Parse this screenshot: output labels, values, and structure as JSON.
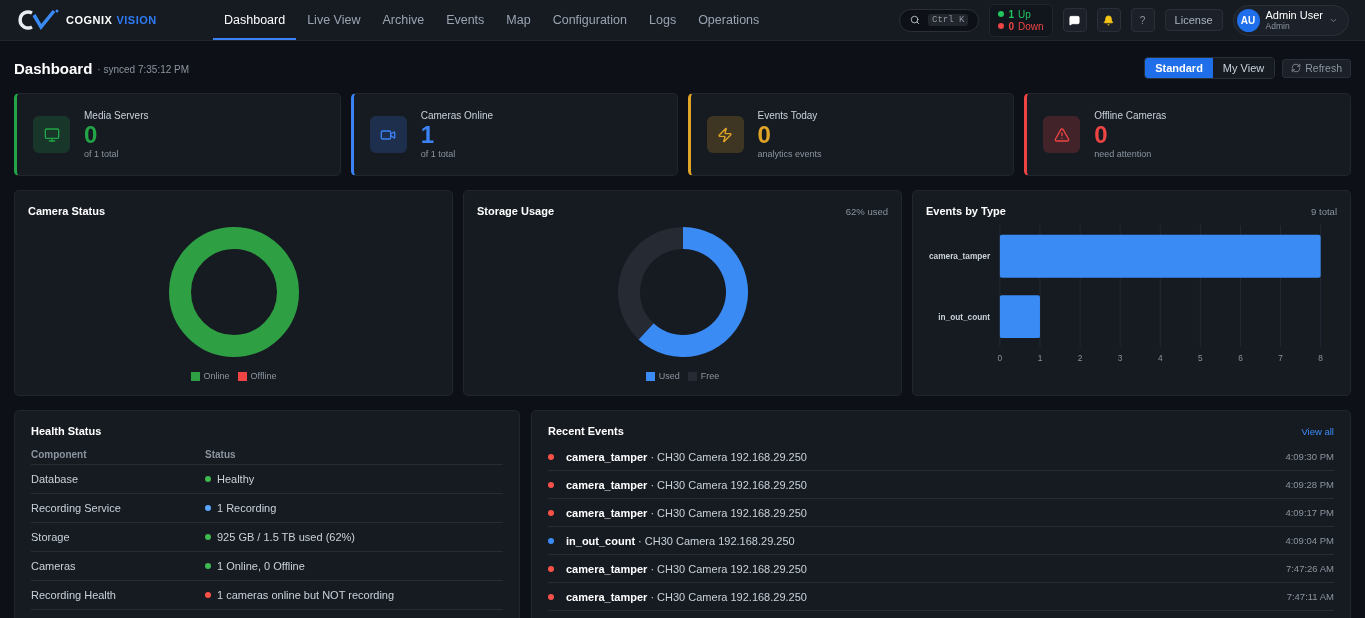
{
  "brand": {
    "first": "COGNIX",
    "second": "VISION"
  },
  "nav": [
    {
      "label": "Dashboard",
      "selected": true
    },
    {
      "label": "Live View",
      "selected": false
    },
    {
      "label": "Archive",
      "selected": false
    },
    {
      "label": "Events",
      "selected": false
    },
    {
      "label": "Map",
      "selected": false
    },
    {
      "label": "Configuration",
      "selected": false
    },
    {
      "label": "Logs",
      "selected": false
    },
    {
      "label": "Operations",
      "selected": false
    }
  ],
  "search": {
    "shortcut": "Ctrl K"
  },
  "server_status": [
    {
      "count": "1",
      "label": "Up",
      "color": "#22c55e"
    },
    {
      "count": "0",
      "label": "Down",
      "color": "#ef4444"
    }
  ],
  "help_label": "?",
  "license_button": "License",
  "user": {
    "initials": "AU",
    "name": "Admin User",
    "role": "Admin"
  },
  "page": {
    "title": "Dashboard",
    "synced": "· synced 7:35:12 PM"
  },
  "views": [
    {
      "label": "Standard",
      "selected": true
    },
    {
      "label": "My View",
      "selected": false
    }
  ],
  "refresh_button": "Refresh",
  "stats": [
    {
      "kind": "monitor",
      "label": "Media Servers",
      "value": "0",
      "sub": "of 1 total",
      "color": "#22a447"
    },
    {
      "kind": "video",
      "label": "Cameras Online",
      "value": "1",
      "sub": "of 1 total",
      "color": "#3b82f6"
    },
    {
      "kind": "zap",
      "label": "Events Today",
      "value": "0",
      "sub": "analytics events",
      "color": "#e0a526"
    },
    {
      "kind": "alert",
      "label": "Offline Cameras",
      "value": "0",
      "sub": "need attention",
      "color": "#ef4444"
    }
  ],
  "camera_status": {
    "title": "Camera Status",
    "legend": [
      {
        "label": "Online",
        "color": "#2ea043"
      },
      {
        "label": "Offline",
        "color": "#ef4444"
      }
    ]
  },
  "storage_usage": {
    "title": "Storage Usage",
    "note": "62% used",
    "chart_data": {
      "type": "donut",
      "categories": [
        "Used",
        "Free"
      ],
      "values": [
        62,
        38
      ],
      "colors": [
        "#3b8bf5",
        "#252a33"
      ]
    }
  },
  "events_by_type": {
    "title": "Events by Type",
    "note": "9 total",
    "chart_data": {
      "type": "bar",
      "orientation": "horizontal",
      "grid": true,
      "categories": [
        "camera_tamper",
        "in_out_count"
      ],
      "values": [
        8,
        1
      ],
      "xlim": [
        0,
        8
      ],
      "xticks": [
        0,
        1,
        2,
        3,
        4,
        5,
        6,
        7,
        8
      ]
    }
  },
  "health": {
    "title": "Health Status",
    "columns": [
      "Component",
      "Status"
    ],
    "rows": [
      {
        "component": "Database",
        "status": "Healthy",
        "color": "#3fb950"
      },
      {
        "component": "Recording Service",
        "status": "1 Recording",
        "color": "#58a6ff"
      },
      {
        "component": "Storage",
        "status": "925 GB / 1.5 TB used (62%)",
        "color": "#3fb950"
      },
      {
        "component": "Cameras",
        "status": "1 Online, 0 Offline",
        "color": "#3fb950"
      },
      {
        "component": "Recording Health",
        "status": "1 cameras online but NOT recording",
        "color": "#f85149"
      }
    ]
  },
  "recent_events": {
    "title": "Recent Events",
    "link": "View all",
    "items": [
      {
        "text": "**camera_tamper** · CH30 Camera 192.168.29.250",
        "time": "4:09:30 PM",
        "color": "#f85149"
      },
      {
        "text": "**camera_tamper** · CH30 Camera 192.168.29.250",
        "time": "4:09:28 PM",
        "color": "#f85149"
      },
      {
        "text": "**camera_tamper** · CH30 Camera 192.168.29.250",
        "time": "4:09:17 PM",
        "color": "#f85149"
      },
      {
        "text": "**in_out_count** · CH30 Camera 192.168.29.250",
        "time": "4:09:04 PM",
        "color": "#3b8bf5"
      },
      {
        "text": "**camera_tamper** · CH30 Camera 192.168.29.250",
        "time": "7:47:26 AM",
        "color": "#f85149"
      },
      {
        "text": "**camera_tamper** · CH30 Camera 192.168.29.250",
        "time": "7:47:11 AM",
        "color": "#f85149"
      }
    ]
  }
}
